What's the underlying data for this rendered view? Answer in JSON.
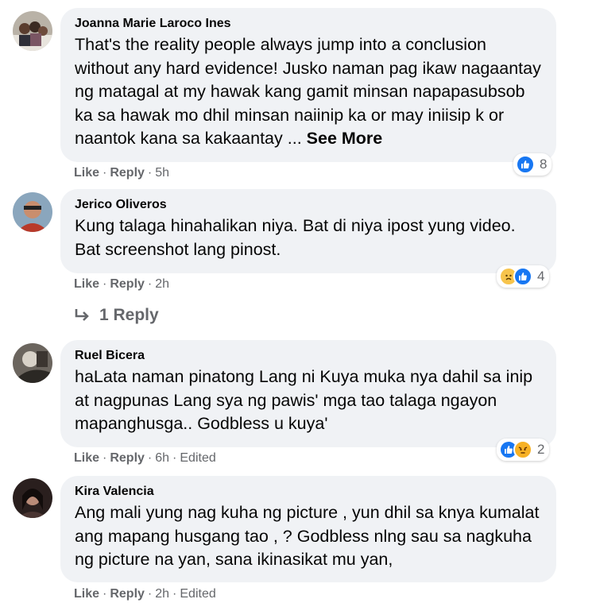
{
  "comments": [
    {
      "author": "Joanna Marie Laroco Ines",
      "text": "That's the reality people always jump into a conclusion without any hard evidence! Jusko naman pag ikaw nagaantay ng matagal at my hawak kang gamit minsan napapasubsob ka sa hawak mo dhil minsan naiinip ka or may iniisip k or naantok kana sa kakaantay ... ",
      "see_more": "See More",
      "like": "Like",
      "reply": "Reply",
      "time": "5h",
      "edited": "",
      "reactions": [
        "like"
      ],
      "reaction_count": "8"
    },
    {
      "author": "Jerico Oliveros",
      "text": "Kung talaga hinahalikan niya. Bat di niya ipost yung video. Bat screenshot lang pinost.",
      "like": "Like",
      "reply": "Reply",
      "time": "2h",
      "edited": "",
      "reactions": [
        "sad",
        "like"
      ],
      "reaction_count": "4",
      "replies_label": "1 Reply"
    },
    {
      "author": "Ruel Bicera",
      "text": "haLata naman pinatong Lang ni Kuya muka nya dahil sa inip at nagpunas Lang sya ng pawis' mga tao talaga ngayon mapanghusga.. Godbless u kuya'",
      "like": "Like",
      "reply": "Reply",
      "time": "6h",
      "edited": "Edited",
      "reactions": [
        "like",
        "angry"
      ],
      "reaction_count": "2"
    },
    {
      "author": "Kira Valencia",
      "text": "Ang mali yung nag kuha ng picture , yun dhil sa knya kumalat ang mapang husgang tao , ? Godbless nlng sau sa nagkuha ng picture na yan, sana ikinasikat mu yan,",
      "like": "Like",
      "reply": "Reply",
      "time": "2h",
      "edited": "Edited"
    }
  ],
  "colors": {
    "bubble": "#f0f2f5",
    "meta": "#65676b",
    "like_blue": "#1877f2",
    "sad_yellow": "#f7c44c",
    "angry_orange": "#e9710f"
  }
}
